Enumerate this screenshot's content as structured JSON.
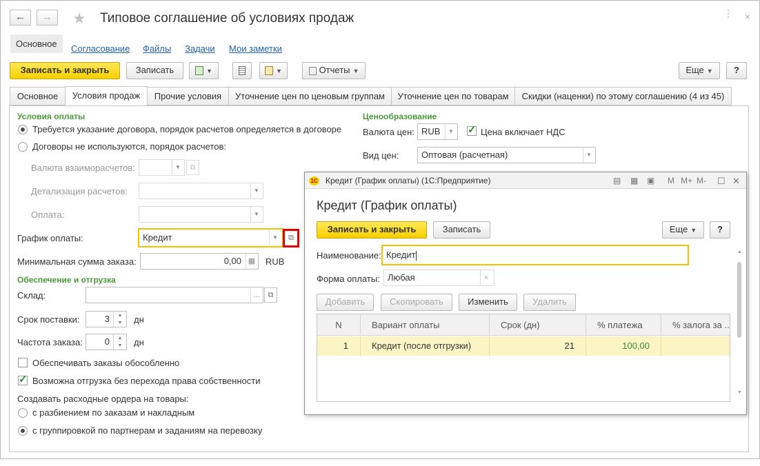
{
  "window": {
    "title": "Типовое соглашение об условиях продаж",
    "back_icon": "←",
    "forward_icon": "→",
    "star_icon": "★",
    "more_icon": "⋮",
    "close_icon": "×"
  },
  "nav_tabs": [
    "Основное",
    "Согласование",
    "Файлы",
    "Задачи",
    "Мои заметки"
  ],
  "toolbar": {
    "save_close": "Записать и закрыть",
    "save": "Записать",
    "reports": "Отчеты",
    "more": "Еще",
    "help": "?"
  },
  "form_tabs": [
    "Основное",
    "Условия продаж",
    "Прочие условия",
    "Уточнение цен по ценовым группам",
    "Уточнение цен по товарам",
    "Скидки (наценки) по этому соглашению (4 из 45)"
  ],
  "payment": {
    "section": "Условия оплаты",
    "radio1": "Требуется указание договора, порядок расчетов определяется в договоре",
    "radio2": "Договоры не используются, порядок расчетов:",
    "currency_label": "Валюта взаиморасчетов:",
    "detail_label": "Детализация расчетов:",
    "payment_label": "Оплата:",
    "schedule_label": "График оплаты:",
    "schedule_value": "Кредит",
    "min_sum_label": "Минимальная сумма заказа:",
    "min_sum_value": "0,00",
    "min_sum_currency": "RUB"
  },
  "shipping": {
    "section": "Обеспечение и отгрузка",
    "warehouse_label": "Склад:",
    "warehouse_value": "",
    "lead_label": "Срок поставки:",
    "lead_value": "3",
    "lead_unit": "дн",
    "freq_label": "Частота заказа:",
    "freq_value": "0",
    "freq_unit": "дн",
    "check1": "Обеспечивать заказы обособленно",
    "check2": "Возможна отгрузка без перехода права собственности",
    "orders_label": "Создавать расходные ордера на товары:",
    "radio_split": "с разбиением по заказам и накладным",
    "radio_group": "с группировкой по партнерам и заданиям на перевозку"
  },
  "pricing": {
    "section": "Ценообразование",
    "currency_label": "Валюта цен:",
    "currency_value": "RUB",
    "vat_label": "Цена включает НДС",
    "price_type_label": "Вид цен:",
    "price_type_value": "Оптовая (расчетная)"
  },
  "popup": {
    "window_title": "Кредит (График оплаты)  (1С:Предприятие)",
    "logo": "1С",
    "heading": "Кредит (График оплаты)",
    "save_close": "Записать и закрыть",
    "save": "Записать",
    "more": "Еще",
    "help": "?",
    "name_label": "Наименование:",
    "name_value": "Кредит",
    "form_label": "Форма оплаты:",
    "form_value": "Любая",
    "btn_add": "Добавить",
    "btn_copy": "Скопировать",
    "btn_edit": "Изменить",
    "btn_delete": "Удалить",
    "icon_m": "M",
    "icon_mplus": "M+",
    "icon_mminus": "M-",
    "table": {
      "columns": [
        "N",
        "Вариант оплаты",
        "Срок (дн)",
        "% платежа",
        "% залога за ..."
      ],
      "rows": [
        {
          "n": "1",
          "variant": "Кредит (после отгрузки)",
          "days": "21",
          "pct": "100,00",
          "deposit": ""
        }
      ]
    }
  }
}
